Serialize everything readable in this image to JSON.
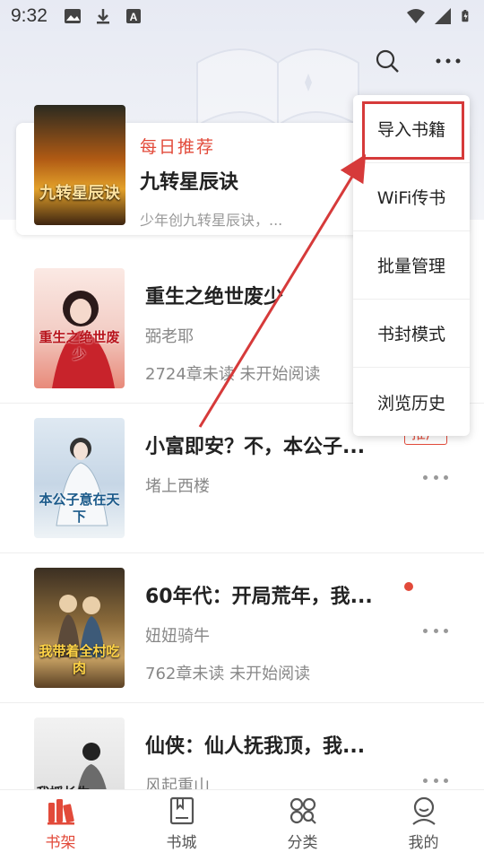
{
  "status_bar": {
    "time": "9:32",
    "icons": [
      "image-icon",
      "download-icon",
      "a-badge-icon",
      "wifi-icon",
      "cell-signal-icon",
      "battery-charging-icon"
    ]
  },
  "header": {
    "actions": [
      "search-icon",
      "more-icon"
    ]
  },
  "featured": {
    "tag": "每日推荐",
    "title": "九转星辰诀",
    "description": "少年创九转星辰诀，...",
    "cover_title": "九转星辰诀"
  },
  "books": [
    {
      "title": "重生之绝世废少",
      "author": "弼老耶",
      "progress": "2724章未读 未开始阅读",
      "cover_title": "重生之绝世废少",
      "badge": ""
    },
    {
      "title": "小富即安？不，本公子...",
      "author": "堵上西楼",
      "progress": "",
      "cover_title": "本公子意在天下",
      "badge": "推广"
    },
    {
      "title": "60年代：开局荒年，我...",
      "author": "妞妞骑牛",
      "progress": "762章未读 未开始阅读",
      "cover_title": "我带着全村吃肉",
      "badge": ""
    },
    {
      "title": "仙侠：仙人抚我顶，我...",
      "author": "风起重山",
      "progress": "",
      "cover_title": "我授长生",
      "badge": ""
    }
  ],
  "menu": {
    "items": [
      "导入书籍",
      "WiFi传书",
      "批量管理",
      "书封模式",
      "浏览历史"
    ],
    "highlighted_index": 0
  },
  "bottom_nav": {
    "items": [
      {
        "label": "书架",
        "icon": "bookshelf-icon",
        "active": true
      },
      {
        "label": "书城",
        "icon": "bookstore-icon",
        "active": false
      },
      {
        "label": "分类",
        "icon": "category-icon",
        "active": false
      },
      {
        "label": "我的",
        "icon": "profile-icon",
        "active": false
      }
    ]
  },
  "colors": {
    "accent": "#e24a3a",
    "highlight_box": "#d63a3a"
  }
}
